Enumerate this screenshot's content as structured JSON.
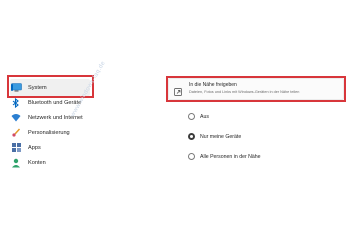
{
  "sidebar": {
    "items": [
      {
        "label": "System",
        "icon": "monitor-icon",
        "selected": true
      },
      {
        "label": "Bluetooth und Geräte",
        "icon": "bluetooth-icon",
        "selected": false
      },
      {
        "label": "Netzwerk und Internet",
        "icon": "wifi-icon",
        "selected": false
      },
      {
        "label": "Personalisierung",
        "icon": "brush-icon",
        "selected": false
      },
      {
        "label": "Apps",
        "icon": "apps-icon",
        "selected": false
      },
      {
        "label": "Konten",
        "icon": "account-icon",
        "selected": false
      }
    ]
  },
  "nearby_sharing": {
    "title": "In die Nähe freigeben",
    "subtitle": "Dateien, Fotos und Links mit Windows-Geräten in der Nähe teilen",
    "icon": "share-device-icon",
    "options": [
      {
        "label": "Aus",
        "checked": false
      },
      {
        "label": "Nur meine Geräte",
        "checked": true
      },
      {
        "label": "Alle Personen in der Nähe",
        "checked": false
      }
    ]
  },
  "watermark": "www.windows-faq.de",
  "colors": {
    "highlight": "#d8363b",
    "accent": "#0067c0"
  }
}
